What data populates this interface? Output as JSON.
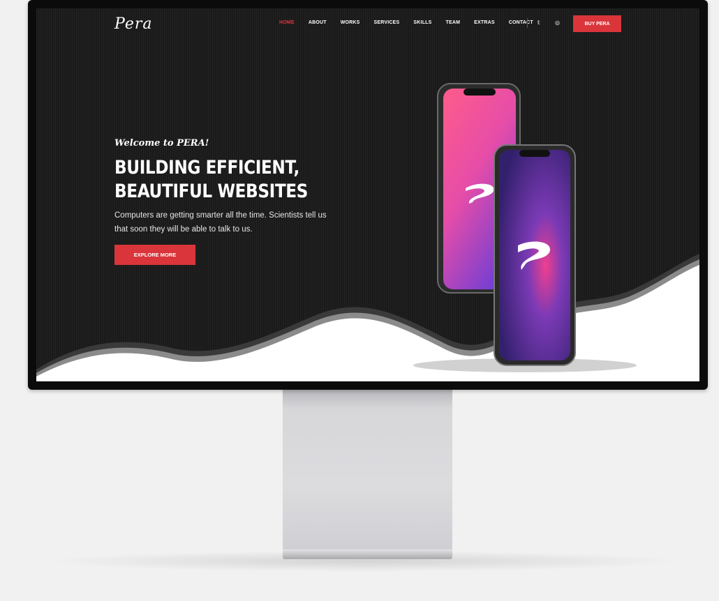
{
  "logo": "Pera",
  "nav": {
    "items": [
      {
        "label": "HOME",
        "active": true
      },
      {
        "label": "ABOUT",
        "active": false
      },
      {
        "label": "WORKS",
        "active": false
      },
      {
        "label": "SERVICES",
        "active": false
      },
      {
        "label": "SKILLS",
        "active": false
      },
      {
        "label": "TEAM",
        "active": false
      },
      {
        "label": "EXTRAS",
        "active": false
      },
      {
        "label": "CONTACT",
        "active": false
      }
    ],
    "social": [
      {
        "icon": "twitter-icon",
        "glyph": "𝕥"
      },
      {
        "icon": "instagram-icon",
        "glyph": "◎"
      }
    ],
    "buy_label": "BUY PERA"
  },
  "hero": {
    "welcome": "Welcome to PERA!",
    "headline_line1": "BUILDING EFFICIENT,",
    "headline_line2": "BEAUTIFUL WEBSITES",
    "subtext": "Computers are getting smarter all the time. Scientists tell us that soon they will be able to talk to us.",
    "cta_label": "EXPLORE MORE"
  },
  "colors": {
    "accent": "#d9353a",
    "background": "#1a1a1a"
  }
}
